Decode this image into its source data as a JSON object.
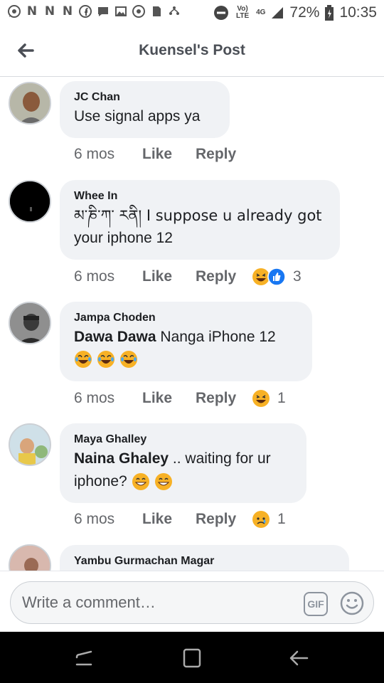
{
  "status_bar": {
    "left_icons": [
      "whatsapp-icon",
      "n-icon",
      "n-icon",
      "n-icon",
      "facebook-icon",
      "messenger-icon",
      "gallery-icon",
      "camera-icon",
      "sim-icon",
      "network-icon"
    ],
    "n_glyph": "N",
    "volte": "Vo) LTE",
    "net": "4G",
    "battery": "72%",
    "time": "10:35"
  },
  "header": {
    "title": "Kuensel's Post"
  },
  "comments": [
    {
      "author": "JC Chan",
      "mention": "",
      "text": "Use signal apps ya",
      "time": "6 mos",
      "like": "Like",
      "reply": "Reply",
      "reactions": [],
      "reaction_count": ""
    },
    {
      "author": "Whee In",
      "mention": "",
      "text_line1": "མ་ཎི་ཀ་ རནི། I suppose u already got",
      "text_line2": "your iphone 12",
      "time": "6 mos",
      "like": "Like",
      "reply": "Reply",
      "reactions": [
        "laughing-emoji",
        "like-emoji"
      ],
      "reaction_count": "3"
    },
    {
      "author": "Jampa Choden",
      "mention": "Dawa Dawa",
      "text": " Nanga iPhone 12",
      "emojis": [
        "joy-emoji",
        "joy-emoji",
        "joy-emoji"
      ],
      "time": "6 mos",
      "like": "Like",
      "reply": "Reply",
      "reactions": [
        "laughing-emoji"
      ],
      "reaction_count": "1"
    },
    {
      "author": "Maya Ghalley",
      "mention": "Naina Ghaley",
      "text": " .. waiting for ur",
      "text_line2": "iphone?",
      "emojis": [
        "grin-emoji",
        "grin-emoji"
      ],
      "time": "6 mos",
      "like": "Like",
      "reply": "Reply",
      "reactions": [
        "sad-emoji"
      ],
      "reaction_count": "1"
    },
    {
      "author": "Yambu Gurmachan Magar"
    }
  ],
  "composer": {
    "placeholder": "Write a comment…",
    "gif_label": "GIF"
  },
  "nav": [
    "recents-button",
    "home-button",
    "back-button"
  ],
  "colors": {
    "bubble": "#f0f2f5",
    "meta": "#65676b",
    "header_title": "#4b4f56",
    "emoji_yellow": "#f7b125",
    "like_blue": "#1877f2"
  }
}
